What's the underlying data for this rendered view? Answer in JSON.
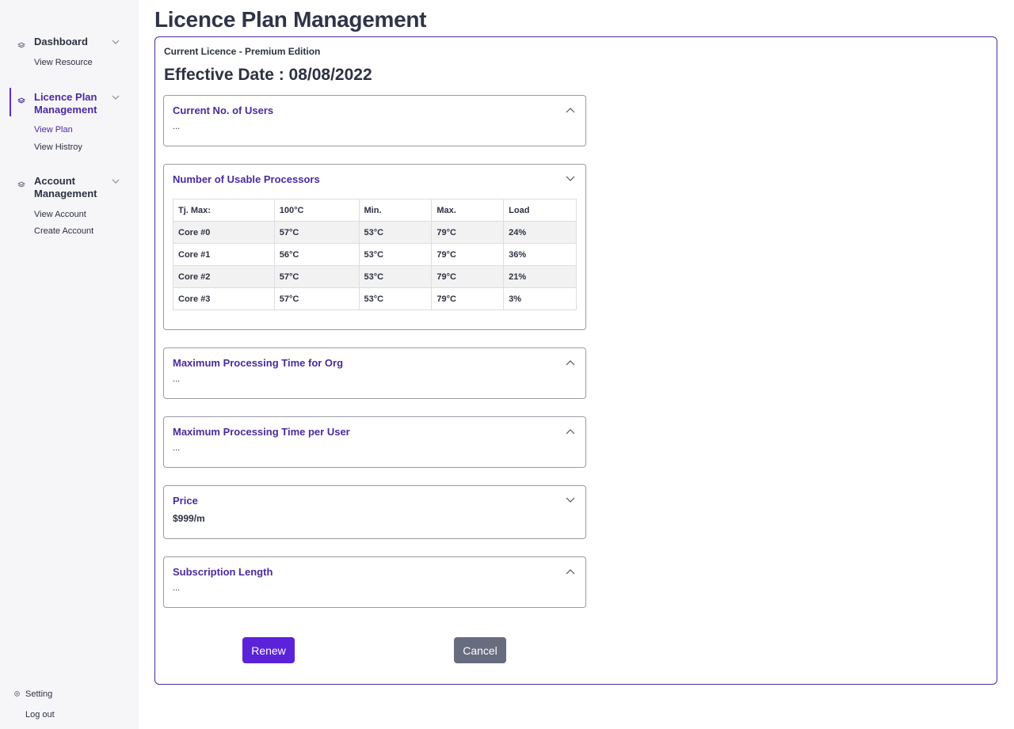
{
  "sidebar": {
    "groups": [
      {
        "title": "Dashboard",
        "items": [
          "View Resource"
        ]
      },
      {
        "title": "Licence Plan Management",
        "items": [
          "View Plan",
          "View Histroy"
        ]
      },
      {
        "title": "Account Management",
        "items": [
          "View Account",
          "Create Account"
        ]
      }
    ],
    "active_group": "Licence Plan Management",
    "active_item": "View Plan",
    "bottom": {
      "setting": "Setting",
      "logout": "Log out"
    }
  },
  "page": {
    "title": "Licence Plan Management",
    "licence_label": "Current Licence - Premium Edition",
    "effective_date": "Effective Date : 08/08/2022"
  },
  "sections": [
    {
      "title": "Current No. of Users",
      "body": "...",
      "expanded": false
    },
    {
      "title": "Number of Usable Processors",
      "expanded": true,
      "table": {
        "header": [
          "Tj. Max:",
          "100°C",
          "Min.",
          "Max.",
          "Load"
        ],
        "rows": [
          [
            "Core #0",
            "57°C",
            "53°C",
            "79°C",
            "24%"
          ],
          [
            "Core #1",
            "56°C",
            "53°C",
            "79°C",
            "36%"
          ],
          [
            "Core #2",
            "57°C",
            "53°C",
            "79°C",
            "21%"
          ],
          [
            "Core #3",
            "57°C",
            "53°C",
            "79°C",
            "3%"
          ]
        ]
      }
    },
    {
      "title": "Maximum Processing Time for Org",
      "body": "...",
      "expanded": false
    },
    {
      "title": "Maximum Processing Time per User",
      "body": "...",
      "expanded": false
    },
    {
      "title": "Price",
      "body": "$999/m",
      "expanded": true
    },
    {
      "title": "Subscription Length",
      "body": "...",
      "expanded": false
    }
  ],
  "actions": {
    "renew": "Renew",
    "cancel": "Cancel"
  },
  "colors": {
    "accent": "#4b2a9e",
    "renew_button": "#5b22d9",
    "cancel_button": "#676c7e",
    "sidebar_bg": "#f6f6f9"
  }
}
